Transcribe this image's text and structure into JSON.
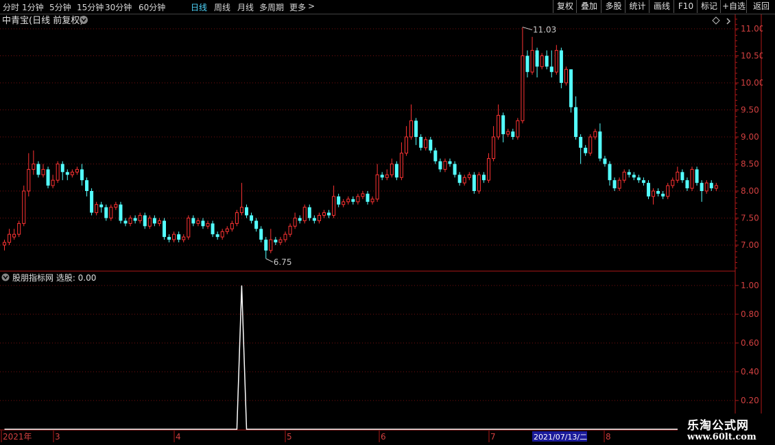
{
  "toolbar": {
    "periods": [
      "分时",
      "1分钟",
      "5分钟",
      "15分钟",
      "30分钟",
      "60分钟",
      "日线",
      "周线",
      "月线",
      "多周期",
      "更多"
    ],
    "active_period": "日线",
    "more_arrow": ">",
    "buttons": [
      "复权",
      "叠加",
      "多股",
      "统计",
      "画线",
      "F10",
      "标记",
      "+自选",
      "返回"
    ]
  },
  "main_panel": {
    "title": "中青宝(日线 前复权)",
    "high_marker": "11.03",
    "low_marker": "6.75",
    "y_ticks": [
      "11.00",
      "10.50",
      "10.00",
      "9.50",
      "9.00",
      "8.50",
      "8.00",
      "7.50",
      "7.00"
    ]
  },
  "indicator_panel": {
    "title": "股朋指标网 选股: 0.00",
    "y_ticks": [
      "1.00",
      "0.80",
      "0.60",
      "0.40",
      "0.20"
    ]
  },
  "date_axis": {
    "labels": [
      "2021年",
      "3",
      "4",
      "5",
      "6",
      "7",
      "8"
    ],
    "highlight": "2021/07/13/二"
  },
  "watermark": {
    "line1": "乐淘公式网",
    "line2": "www.60lt.com"
  },
  "colors": {
    "up": "#ff3333",
    "down": "#54ffff",
    "axis": "#b01818",
    "grid": "#7a1010",
    "active": "#4fd8ff"
  },
  "chart_data": {
    "type": "candlestick",
    "price_range": [
      6.5,
      11.25
    ],
    "candles": [
      [
        7.0,
        7.05,
        6.9,
        7.1
      ],
      [
        7.05,
        7.2,
        7.0,
        7.3
      ],
      [
        7.15,
        7.2,
        7.1,
        7.3
      ],
      [
        7.2,
        7.4,
        7.15,
        7.45
      ],
      [
        7.4,
        8.0,
        7.35,
        8.1
      ],
      [
        8.0,
        8.4,
        7.9,
        8.7
      ],
      [
        8.4,
        8.5,
        8.3,
        8.75
      ],
      [
        8.5,
        8.3,
        8.25,
        8.55
      ],
      [
        8.3,
        8.4,
        8.25,
        8.5
      ],
      [
        8.4,
        8.1,
        8.05,
        8.45
      ],
      [
        8.1,
        8.2,
        8.05,
        8.3
      ],
      [
        8.2,
        8.5,
        8.15,
        8.55
      ],
      [
        8.5,
        8.35,
        8.2,
        8.55
      ],
      [
        8.35,
        8.3,
        8.2,
        8.4
      ],
      [
        8.3,
        8.35,
        8.25,
        8.4
      ],
      [
        8.35,
        8.4,
        8.3,
        8.45
      ],
      [
        8.4,
        8.2,
        8.1,
        8.5
      ],
      [
        8.2,
        8.0,
        7.9,
        8.25
      ],
      [
        8.0,
        7.6,
        7.55,
        8.05
      ],
      [
        7.6,
        7.75,
        7.55,
        7.8
      ],
      [
        7.75,
        7.7,
        7.6,
        7.8
      ],
      [
        7.7,
        7.5,
        7.45,
        7.75
      ],
      [
        7.5,
        7.7,
        7.45,
        7.75
      ],
      [
        7.7,
        7.75,
        7.65,
        7.8
      ],
      [
        7.75,
        7.45,
        7.4,
        7.8
      ],
      [
        7.45,
        7.4,
        7.35,
        7.5
      ],
      [
        7.4,
        7.5,
        7.35,
        7.55
      ],
      [
        7.5,
        7.45,
        7.4,
        7.55
      ],
      [
        7.45,
        7.55,
        7.4,
        7.6
      ],
      [
        7.55,
        7.35,
        7.3,
        7.6
      ],
      [
        7.35,
        7.5,
        7.3,
        7.55
      ],
      [
        7.5,
        7.4,
        7.35,
        7.55
      ],
      [
        7.4,
        7.45,
        7.35,
        7.5
      ],
      [
        7.45,
        7.15,
        7.1,
        7.5
      ],
      [
        7.15,
        7.1,
        7.05,
        7.2
      ],
      [
        7.1,
        7.2,
        7.05,
        7.25
      ],
      [
        7.2,
        7.1,
        7.05,
        7.25
      ],
      [
        7.1,
        7.15,
        7.05,
        7.2
      ],
      [
        7.15,
        7.5,
        7.1,
        7.55
      ],
      [
        7.5,
        7.4,
        7.35,
        7.55
      ],
      [
        7.4,
        7.45,
        7.35,
        7.5
      ],
      [
        7.45,
        7.35,
        7.3,
        7.5
      ],
      [
        7.35,
        7.4,
        7.3,
        7.45
      ],
      [
        7.4,
        7.2,
        7.15,
        7.45
      ],
      [
        7.2,
        7.15,
        7.1,
        7.25
      ],
      [
        7.15,
        7.25,
        7.1,
        7.3
      ],
      [
        7.25,
        7.3,
        7.2,
        7.35
      ],
      [
        7.3,
        7.4,
        7.25,
        7.45
      ],
      [
        7.4,
        7.6,
        7.35,
        7.65
      ],
      [
        7.6,
        7.7,
        7.55,
        8.15
      ],
      [
        7.7,
        7.55,
        7.5,
        7.75
      ],
      [
        7.55,
        7.45,
        7.4,
        7.6
      ],
      [
        7.45,
        7.3,
        7.25,
        7.5
      ],
      [
        7.3,
        7.1,
        7.05,
        7.35
      ],
      [
        7.1,
        6.9,
        6.75,
        7.15
      ],
      [
        6.9,
        7.1,
        6.85,
        7.3
      ],
      [
        7.1,
        7.05,
        7.0,
        7.15
      ],
      [
        7.05,
        7.1,
        7.0,
        7.15
      ],
      [
        7.1,
        7.2,
        7.05,
        7.25
      ],
      [
        7.2,
        7.35,
        7.15,
        7.4
      ],
      [
        7.35,
        7.5,
        7.3,
        7.6
      ],
      [
        7.5,
        7.45,
        7.4,
        7.55
      ],
      [
        7.45,
        7.7,
        7.4,
        7.75
      ],
      [
        7.7,
        7.5,
        7.45,
        7.75
      ],
      [
        7.5,
        7.45,
        7.4,
        7.55
      ],
      [
        7.45,
        7.55,
        7.4,
        7.6
      ],
      [
        7.55,
        7.6,
        7.5,
        7.65
      ],
      [
        7.6,
        7.55,
        7.5,
        7.65
      ],
      [
        7.55,
        7.9,
        7.5,
        8.1
      ],
      [
        7.9,
        7.75,
        7.7,
        7.95
      ],
      [
        7.75,
        7.8,
        7.7,
        7.85
      ],
      [
        7.8,
        7.85,
        7.75,
        7.9
      ],
      [
        7.85,
        7.8,
        7.75,
        7.9
      ],
      [
        7.8,
        7.9,
        7.75,
        7.95
      ],
      [
        7.9,
        7.95,
        7.85,
        8.0
      ],
      [
        7.95,
        7.8,
        7.75,
        8.0
      ],
      [
        7.8,
        7.85,
        7.75,
        7.9
      ],
      [
        7.85,
        8.3,
        7.8,
        8.5
      ],
      [
        8.3,
        8.25,
        8.2,
        8.35
      ],
      [
        8.25,
        8.3,
        8.2,
        8.4
      ],
      [
        8.3,
        8.5,
        8.25,
        8.6
      ],
      [
        8.5,
        8.25,
        8.2,
        8.55
      ],
      [
        8.25,
        8.7,
        8.2,
        8.9
      ],
      [
        8.7,
        9.0,
        8.65,
        9.2
      ],
      [
        9.0,
        9.3,
        8.95,
        9.6
      ],
      [
        9.3,
        9.0,
        8.85,
        9.35
      ],
      [
        9.0,
        8.8,
        8.75,
        9.05
      ],
      [
        8.8,
        8.95,
        8.75,
        9.0
      ],
      [
        8.95,
        8.75,
        8.7,
        9.0
      ],
      [
        8.75,
        8.55,
        8.5,
        8.8
      ],
      [
        8.55,
        8.4,
        8.35,
        8.6
      ],
      [
        8.4,
        8.55,
        8.35,
        8.6
      ],
      [
        8.55,
        8.5,
        8.45,
        8.6
      ],
      [
        8.5,
        8.3,
        8.25,
        8.55
      ],
      [
        8.3,
        8.15,
        8.1,
        8.35
      ],
      [
        8.15,
        8.25,
        8.1,
        8.3
      ],
      [
        8.25,
        8.3,
        8.2,
        8.35
      ],
      [
        8.3,
        8.0,
        7.95,
        8.35
      ],
      [
        8.0,
        8.3,
        7.95,
        8.35
      ],
      [
        8.3,
        8.2,
        8.15,
        8.35
      ],
      [
        8.2,
        8.6,
        8.15,
        8.7
      ],
      [
        8.6,
        9.0,
        8.55,
        9.2
      ],
      [
        9.0,
        9.4,
        8.95,
        9.6
      ],
      [
        9.4,
        9.05,
        8.9,
        9.45
      ],
      [
        9.05,
        9.1,
        9.0,
        9.15
      ],
      [
        9.1,
        9.0,
        8.95,
        9.15
      ],
      [
        9.0,
        9.3,
        8.95,
        9.35
      ],
      [
        9.3,
        10.5,
        9.25,
        11.03
      ],
      [
        10.5,
        10.2,
        10.1,
        10.6
      ],
      [
        10.2,
        10.6,
        10.15,
        10.85
      ],
      [
        10.6,
        10.3,
        10.1,
        10.65
      ],
      [
        10.3,
        10.5,
        10.25,
        10.55
      ],
      [
        10.5,
        10.3,
        10.25,
        10.6
      ],
      [
        10.3,
        10.2,
        10.1,
        10.6
      ],
      [
        10.2,
        10.6,
        10.15,
        10.7
      ],
      [
        10.6,
        10.0,
        9.9,
        10.65
      ],
      [
        10.0,
        10.25,
        9.95,
        10.3
      ],
      [
        10.25,
        9.55,
        9.45,
        10.2
      ],
      [
        9.55,
        9.0,
        8.95,
        9.75
      ],
      [
        9.0,
        8.8,
        8.5,
        9.05
      ],
      [
        8.8,
        8.7,
        8.65,
        8.85
      ],
      [
        8.7,
        9.0,
        8.65,
        9.05
      ],
      [
        9.0,
        9.1,
        8.95,
        9.15
      ],
      [
        9.1,
        8.6,
        8.55,
        9.25
      ],
      [
        8.6,
        8.5,
        8.45,
        8.65
      ],
      [
        8.5,
        8.2,
        8.1,
        8.55
      ],
      [
        8.2,
        8.05,
        8.0,
        8.25
      ],
      [
        8.05,
        8.2,
        8.0,
        8.25
      ],
      [
        8.2,
        8.35,
        8.15,
        8.4
      ],
      [
        8.35,
        8.3,
        8.25,
        8.4
      ],
      [
        8.3,
        8.25,
        8.2,
        8.35
      ],
      [
        8.25,
        8.2,
        8.15,
        8.3
      ],
      [
        8.2,
        8.15,
        8.1,
        8.25
      ],
      [
        8.15,
        7.9,
        7.85,
        8.2
      ],
      [
        7.9,
        8.0,
        7.75,
        8.05
      ],
      [
        8.0,
        7.95,
        7.9,
        8.05
      ],
      [
        7.95,
        7.9,
        7.85,
        8.0
      ],
      [
        7.9,
        8.1,
        7.85,
        8.15
      ],
      [
        8.1,
        8.2,
        8.05,
        8.25
      ],
      [
        8.2,
        8.35,
        8.15,
        8.45
      ],
      [
        8.35,
        8.2,
        8.15,
        8.4
      ],
      [
        8.2,
        8.05,
        8.0,
        8.25
      ],
      [
        8.05,
        8.4,
        8.0,
        8.45
      ],
      [
        8.4,
        8.15,
        8.1,
        8.45
      ],
      [
        8.15,
        8.0,
        7.8,
        8.2
      ],
      [
        8.0,
        8.15,
        7.95,
        8.2
      ],
      [
        8.15,
        8.05,
        8.0,
        8.2
      ],
      [
        8.05,
        8.1,
        8.0,
        8.15
      ]
    ],
    "indicator": {
      "name": "选股",
      "range": [
        0,
        1.05
      ],
      "values": [
        0,
        0,
        0,
        0,
        0,
        0,
        0,
        0,
        0,
        0,
        0,
        0,
        0,
        0,
        0,
        0,
        0,
        0,
        0,
        0,
        0,
        0,
        0,
        0,
        0,
        0,
        0,
        0,
        0,
        0,
        0,
        0,
        0,
        0,
        0,
        0,
        0,
        0,
        0,
        0,
        0,
        0,
        0,
        0,
        0,
        0,
        0,
        0,
        0,
        1,
        0,
        0,
        0,
        0,
        0,
        0,
        0,
        0,
        0,
        0,
        0,
        0,
        0,
        0,
        0,
        0,
        0,
        0,
        0,
        0,
        0,
        0,
        0,
        0,
        0,
        0,
        0,
        0,
        0,
        0,
        0,
        0,
        0,
        0,
        0,
        0,
        0,
        0,
        0,
        0,
        0,
        0,
        0,
        0,
        0,
        0,
        0,
        0,
        0,
        0,
        0,
        0,
        0,
        0,
        0,
        0,
        0,
        0,
        0,
        0,
        0,
        0,
        0,
        0,
        0,
        0,
        0,
        0,
        0,
        0,
        0,
        0,
        0,
        0,
        0,
        0,
        0,
        0,
        0,
        0,
        0,
        0,
        0,
        0,
        0,
        0,
        0,
        0,
        0,
        0,
        0,
        0,
        0,
        0,
        0,
        0,
        0,
        0,
        0,
        0,
        0,
        0
      ]
    }
  }
}
